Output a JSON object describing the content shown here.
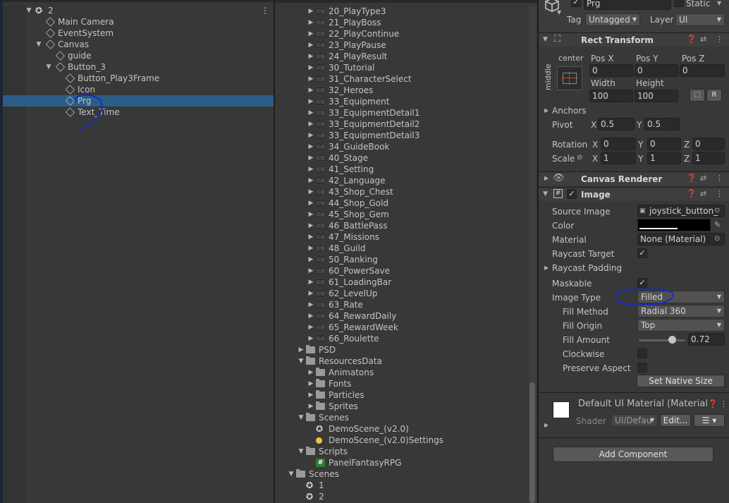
{
  "hierarchy": {
    "scene_name": "2",
    "items": [
      {
        "label": "Main Camera",
        "depth": 1,
        "icon": "gameobject-icon",
        "arrow": ""
      },
      {
        "label": "EventSystem",
        "depth": 1,
        "icon": "gameobject-icon",
        "arrow": ""
      },
      {
        "label": "Canvas",
        "depth": 1,
        "icon": "gameobject-icon",
        "arrow": "open"
      },
      {
        "label": "guide",
        "depth": 2,
        "icon": "gameobject-icon",
        "arrow": ""
      },
      {
        "label": "Button_3",
        "depth": 2,
        "icon": "gameobject-icon",
        "arrow": "open"
      },
      {
        "label": "Button_Play3Frame",
        "depth": 3,
        "icon": "gameobject-icon",
        "arrow": ""
      },
      {
        "label": "Icon",
        "depth": 3,
        "icon": "gameobject-icon",
        "arrow": ""
      },
      {
        "label": "Prg",
        "depth": 3,
        "icon": "gameobject-icon",
        "arrow": "",
        "selected": true
      },
      {
        "label": "Text_Time",
        "depth": 3,
        "icon": "gameobject-icon",
        "arrow": ""
      }
    ]
  },
  "project": {
    "items": [
      {
        "label": "20_PlayType3",
        "kind": "prefab",
        "depth": 3
      },
      {
        "label": "21_PlayBoss",
        "kind": "prefab",
        "depth": 3
      },
      {
        "label": "22_PlayContinue",
        "kind": "prefab",
        "depth": 3
      },
      {
        "label": "23_PlayPause",
        "kind": "prefab",
        "depth": 3
      },
      {
        "label": "24_PlayResult",
        "kind": "prefab",
        "depth": 3
      },
      {
        "label": "30_Tutorial",
        "kind": "prefab",
        "depth": 3
      },
      {
        "label": "31_CharacterSelect",
        "kind": "prefab",
        "depth": 3
      },
      {
        "label": "32_Heroes",
        "kind": "prefab",
        "depth": 3
      },
      {
        "label": "33_Equipment",
        "kind": "prefab",
        "depth": 3
      },
      {
        "label": "33_EquipmentDetail1",
        "kind": "prefab",
        "depth": 3
      },
      {
        "label": "33_EquipmentDetail2",
        "kind": "prefab",
        "depth": 3
      },
      {
        "label": "33_EquipmentDetail3",
        "kind": "prefab",
        "depth": 3
      },
      {
        "label": "34_GuideBook",
        "kind": "prefab",
        "depth": 3
      },
      {
        "label": "40_Stage",
        "kind": "prefab",
        "depth": 3
      },
      {
        "label": "41_Setting",
        "kind": "prefab",
        "depth": 3
      },
      {
        "label": "42_Language",
        "kind": "prefab",
        "depth": 3
      },
      {
        "label": "43_Shop_Chest",
        "kind": "prefab",
        "depth": 3
      },
      {
        "label": "44_Shop_Gold",
        "kind": "prefab",
        "depth": 3
      },
      {
        "label": "45_Shop_Gem",
        "kind": "prefab",
        "depth": 3
      },
      {
        "label": "46_BattlePass",
        "kind": "prefab",
        "depth": 3
      },
      {
        "label": "47_Missions",
        "kind": "prefab",
        "depth": 3
      },
      {
        "label": "48_Guild",
        "kind": "prefab",
        "depth": 3
      },
      {
        "label": "50_Ranking",
        "kind": "prefab",
        "depth": 3
      },
      {
        "label": "60_PowerSave",
        "kind": "prefab",
        "depth": 3
      },
      {
        "label": "61_LoadingBar",
        "kind": "prefab",
        "depth": 3
      },
      {
        "label": "62_LevelUp",
        "kind": "prefab",
        "depth": 3
      },
      {
        "label": "63_Rate",
        "kind": "prefab",
        "depth": 3
      },
      {
        "label": "64_RewardDaily",
        "kind": "prefab",
        "depth": 3
      },
      {
        "label": "65_RewardWeek",
        "kind": "prefab",
        "depth": 3
      },
      {
        "label": "66_Roulette",
        "kind": "prefab",
        "depth": 3
      },
      {
        "label": "PSD",
        "kind": "folder-closed",
        "depth": 2
      },
      {
        "label": "ResourcesData",
        "kind": "folder-open",
        "depth": 2
      },
      {
        "label": "Animatons",
        "kind": "folder-closed",
        "depth": 3
      },
      {
        "label": "Fonts",
        "kind": "folder-closed",
        "depth": 3
      },
      {
        "label": "Particles",
        "kind": "folder-closed",
        "depth": 3
      },
      {
        "label": "Sprites",
        "kind": "folder-closed",
        "depth": 3
      },
      {
        "label": "Scenes",
        "kind": "folder-open",
        "depth": 2
      },
      {
        "label": "DemoScene_(v2.0)",
        "kind": "scene",
        "depth": 3
      },
      {
        "label": "DemoScene_(v2.0)Settings",
        "kind": "settings",
        "depth": 3
      },
      {
        "label": "Scripts",
        "kind": "folder-open",
        "depth": 2
      },
      {
        "label": "PanelFantasyRPG",
        "kind": "script",
        "depth": 3
      },
      {
        "label": "Scenes",
        "kind": "folder-open",
        "depth": 1
      },
      {
        "label": "1",
        "kind": "scene",
        "depth": 2
      },
      {
        "label": "2",
        "kind": "scene",
        "depth": 2
      }
    ]
  },
  "inspector": {
    "object_name": "Prg",
    "static_label": "Static",
    "tag_label": "Tag",
    "tag_value": "Untagged",
    "layer_label": "Layer",
    "layer_value": "UI",
    "rect_transform": {
      "title": "Rect Transform",
      "anchor_h": "center",
      "anchor_v": "middle",
      "pos_x_label": "Pos X",
      "pos_x": "0",
      "pos_y_label": "Pos Y",
      "pos_y": "0",
      "pos_z_label": "Pos Z",
      "pos_z": "0",
      "width_label": "Width",
      "width": "100",
      "height_label": "Height",
      "height": "100",
      "r_button": "R",
      "anchors_label": "Anchors",
      "pivot_label": "Pivot",
      "pivot_x": "0.5",
      "pivot_y": "0.5",
      "rotation_label": "Rotation",
      "rot_x": "0",
      "rot_y": "0",
      "rot_z": "0",
      "scale_label": "Scale",
      "scale_x": "1",
      "scale_y": "1",
      "scale_z": "1",
      "x": "X",
      "y": "Y",
      "z": "Z"
    },
    "canvas_renderer_title": "Canvas Renderer",
    "image": {
      "title": "Image",
      "source_image_label": "Source Image",
      "source_image": "joystick_button_",
      "color_label": "Color",
      "material_label": "Material",
      "material": "None (Material)",
      "raycast_target_label": "Raycast Target",
      "raycast_padding_label": "Raycast Padding",
      "maskable_label": "Maskable",
      "image_type_label": "Image Type",
      "image_type": "Filled",
      "fill_method_label": "Fill Method",
      "fill_method": "Radial 360",
      "fill_origin_label": "Fill Origin",
      "fill_origin": "Top",
      "fill_amount_label": "Fill Amount",
      "fill_amount": "0.72",
      "fill_amount_fraction": 0.72,
      "clockwise_label": "Clockwise",
      "preserve_aspect_label": "Preserve Aspect",
      "set_native_size": "Set Native Size"
    },
    "material_panel": {
      "title": "Default UI Material (Material",
      "shader_label": "Shader",
      "shader_value": "UI/Defau",
      "edit_button": "Edit..."
    },
    "add_component": "Add Component"
  },
  "colors": {
    "selection": "#2c5d87",
    "annotation": "#1428d2",
    "background": "#383838"
  }
}
